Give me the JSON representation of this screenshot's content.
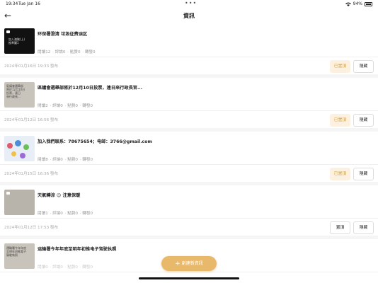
{
  "status": {
    "time": "19:34",
    "date": "Tue Jan 16",
    "battery": "94%"
  },
  "nav": {
    "title": "資訊"
  },
  "items": [
    {
      "thumb_text": "加入澳聚(上)\n推奉圖1",
      "title": "环保署澄清 垃圾征费误区",
      "views": "閱讀12",
      "comments": "評論0",
      "likes": "點贊0",
      "shares": "轉發0",
      "date": "2024年01月16日 19:33 發布",
      "pinned": true,
      "pin_label": "已置頂",
      "hide_label": "隱藏"
    },
    {
      "thumb_text": "區議會選舉部\n將於12月10日\n投票，連日\n來行政長...",
      "title": "區議會選舉部將於12月10日投票，連日來行政長官...",
      "views": "閱讀2",
      "comments": "評論0",
      "likes": "點贊0",
      "shares": "轉發0",
      "date": "2024年01月12日 16:56 發布",
      "pinned": true,
      "pin_label": "已置頂",
      "hide_label": "隱藏"
    },
    {
      "thumb_text": "",
      "title": "加入我們联系：78675654；电邮：3766@gmail.com",
      "views": "閱讀8",
      "comments": "評論0",
      "likes": "點贊0",
      "shares": "轉發0",
      "date": "2024年01月15日 16:36 發布",
      "pinned": true,
      "pin_label": "已置頂",
      "hide_label": "隱藏"
    },
    {
      "thumb_text": "",
      "title": "天氣轉涼 ☺ 注意保暖",
      "views": "閱讀1",
      "comments": "評論0",
      "likes": "點贊0",
      "shares": "轉發0",
      "date": "2024年01月12日 17:53 發布",
      "pinned": false,
      "pin_label": "置頂",
      "hide_label": "隱藏"
    },
    {
      "thumb_text": "運輸署今年年底\n至明年初推電子\n駕駛執照",
      "title": "运输署今年年底至明年初推电子驾驶执照",
      "views": "閱讀0",
      "comments": "評論0",
      "likes": "點贊0",
      "shares": "轉發0",
      "date": "",
      "pinned": false,
      "pin_label": "",
      "hide_label": ""
    }
  ],
  "fab": {
    "label": "創建新資訊",
    "icon": "plus-icon"
  },
  "colors": {
    "accent": "#e9b96b",
    "pinned_bg": "#fcf1e0",
    "pinned_text": "#d4a347"
  }
}
